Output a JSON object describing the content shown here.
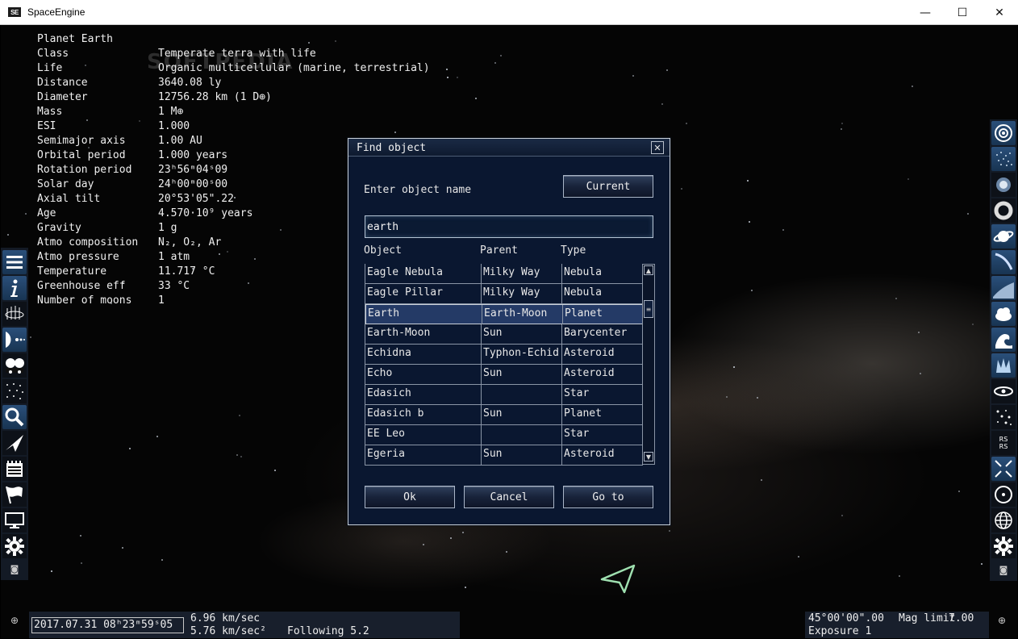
{
  "window": {
    "title": "SpaceEngine",
    "logo_text": "SE",
    "minimize": "—",
    "maximize": "☐",
    "close": "✕"
  },
  "watermark": "SOFTPEDIA",
  "info_panel": {
    "rows": [
      {
        "label": "Planet  Earth",
        "value": ""
      },
      {
        "label": "Class",
        "value": "Temperate terra with life"
      },
      {
        "label": "Life",
        "value": "Organic multicellular (marine, terrestrial)"
      },
      {
        "label": "Distance",
        "value": "3640.08 ly"
      },
      {
        "label": "Diameter",
        "value": "12756.28 km (1 D⊕)"
      },
      {
        "label": "Mass",
        "value": "1 M⊕"
      },
      {
        "label": "ESI",
        "value": "1.000"
      },
      {
        "label": "Semimajor axis",
        "value": "1.00 AU"
      },
      {
        "label": "Orbital period",
        "value": "1.000 years"
      },
      {
        "label": "Rotation period",
        "value": "23ʰ56ᵐ04ˢ09"
      },
      {
        "label": "Solar day",
        "value": "24ʰ00ᵐ00ˢ00"
      },
      {
        "label": "Axial tilt",
        "value": "20°53'05\".22"
      },
      {
        "label": "Age",
        "value": "4.570·10⁹ years"
      },
      {
        "label": "Gravity",
        "value": "1 g"
      },
      {
        "label": "Atmo composition",
        "value": "N₂, O₂, Ar"
      },
      {
        "label": "Atmo pressure",
        "value": "1 atm"
      },
      {
        "label": "Temperature",
        "value": "11.717 °C"
      },
      {
        "label": "Greenhouse eff",
        "value": "33 °C"
      },
      {
        "label": "Number of moons",
        "value": "1"
      }
    ]
  },
  "left_toolbar": {
    "items": [
      {
        "icon": "menu-icon"
      },
      {
        "icon": "info-icon"
      },
      {
        "icon": "star-browser-icon"
      },
      {
        "icon": "solar-system-icon"
      },
      {
        "icon": "planets-icon"
      },
      {
        "icon": "star-field-icon"
      },
      {
        "icon": "search-icon"
      },
      {
        "icon": "ship-icon"
      },
      {
        "icon": "scenario-icon"
      },
      {
        "icon": "flag-icon"
      },
      {
        "icon": "display-icon"
      },
      {
        "icon": "settings-icon"
      }
    ]
  },
  "right_toolbar": {
    "items": [
      {
        "icon": "galaxy-icon"
      },
      {
        "icon": "star-cluster-icon"
      },
      {
        "icon": "globular-cluster-icon"
      },
      {
        "icon": "nebula-ring-icon"
      },
      {
        "icon": "planet-ring-icon"
      },
      {
        "icon": "comet-icon"
      },
      {
        "icon": "atmosphere-icon"
      },
      {
        "icon": "clouds-icon"
      },
      {
        "icon": "water-icon"
      },
      {
        "icon": "aurora-icon"
      },
      {
        "icon": "orbit-icon"
      },
      {
        "icon": "stars-icon"
      },
      {
        "icon": "labels-icon",
        "text": "RS"
      },
      {
        "icon": "fullscreen-icon"
      },
      {
        "icon": "target-icon"
      },
      {
        "icon": "grid-globe-icon"
      },
      {
        "icon": "settings-icon"
      }
    ]
  },
  "dialog": {
    "title": "Find object",
    "close_glyph": "✕",
    "prompt": "Enter object name",
    "current_button": "Current",
    "search_value": "earth",
    "columns": {
      "object": "Object",
      "parent": "Parent",
      "type": "Type"
    },
    "rows": [
      {
        "object": "Eagle Nebula",
        "parent": "Milky Way",
        "type": "Nebula"
      },
      {
        "object": "Eagle Pillar",
        "parent": "Milky Way",
        "type": "Nebula"
      },
      {
        "object": "Earth",
        "parent": "Earth-Moon",
        "type": "Planet"
      },
      {
        "object": "Earth-Moon",
        "parent": "Sun",
        "type": "Barycenter"
      },
      {
        "object": "Echidna",
        "parent": "Typhon-Echid",
        "type": "Asteroid"
      },
      {
        "object": "Echo",
        "parent": "Sun",
        "type": "Asteroid"
      },
      {
        "object": "Edasich",
        "parent": "",
        "type": "Star"
      },
      {
        "object": "Edasich b",
        "parent": "Sun",
        "type": "Planet"
      },
      {
        "object": "EE Leo",
        "parent": "",
        "type": "Star"
      },
      {
        "object": "Egeria",
        "parent": "Sun",
        "type": "Asteroid"
      }
    ],
    "selected_row": "Earth",
    "scroll_up": "▲",
    "scroll_down": "▼",
    "scroll_thumb": "≡",
    "ok_button": "Ok",
    "cancel_button": "Cancel",
    "goto_button": "Go to"
  },
  "status": {
    "date": "2017.07.31 08ʰ23ᵐ59ˢ05",
    "speed1": "6.96 km/sec",
    "speed2": "5.76 km/sec²",
    "following": "Following 5.2",
    "fov": "45°00'00\".00",
    "mag_label": "Mag limit",
    "mag_value": "7.00",
    "exposure": "Exposure 1",
    "left_icon": "⊕",
    "right_icon": "⊕"
  },
  "colors": {
    "toolbar_blue": "#2a4f7a",
    "dialog_bg": "#0a1730",
    "selected_row": "#243a66",
    "cursor": "#9fe0b0"
  }
}
